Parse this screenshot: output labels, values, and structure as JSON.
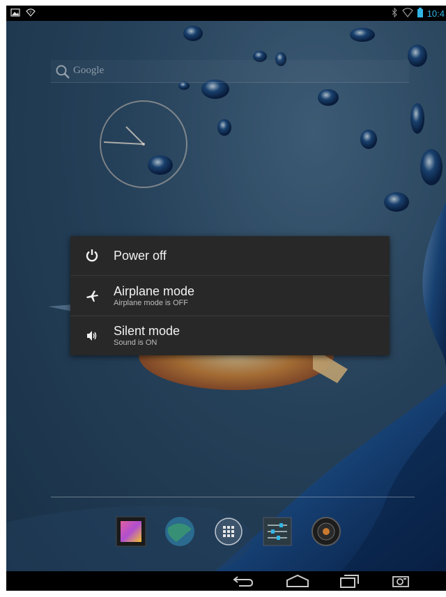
{
  "statusbar": {
    "time": "10:4",
    "left_icons": [
      "image-notification-icon",
      "wifi-notification-icon"
    ],
    "right_icons": [
      "bluetooth-icon",
      "wifi-signal-icon",
      "battery-icon"
    ]
  },
  "homescreen": {
    "search_label": "Google",
    "dock_apps": [
      "gallery-icon",
      "browser-icon",
      "app-drawer-icon",
      "settings-icon",
      "music-icon"
    ]
  },
  "power_dialog": {
    "items": [
      {
        "title": "Power off",
        "subtitle": "",
        "icon": "power-icon"
      },
      {
        "title": "Airplane mode",
        "subtitle": "Airplane mode is OFF",
        "icon": "airplane-icon"
      },
      {
        "title": "Silent mode",
        "subtitle": "Sound is ON",
        "icon": "speaker-icon"
      }
    ]
  },
  "navbar": {
    "buttons": [
      "back-icon",
      "home-icon",
      "recent-apps-icon",
      "screenshot-icon"
    ]
  },
  "colors": {
    "accent": "#33b5e5",
    "dialog_bg": "#282828"
  }
}
